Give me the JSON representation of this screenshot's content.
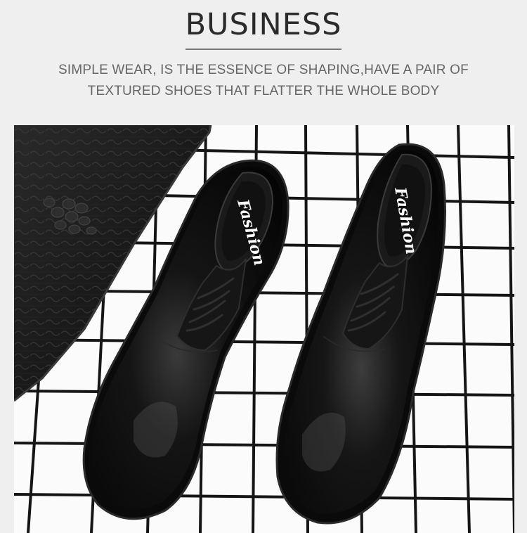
{
  "header": {
    "title": "BUSINESS",
    "subtitle_line1": "SIMPLE WEAR, IS THE ESSENCE OF SHAPING,HAVE A PAIR OF",
    "subtitle_line2": "TEXTURED SHOES THAT FLATTER THE WHOLE BODY"
  },
  "photo": {
    "insole_text_left": "Fashion",
    "insole_text_right": "Fashion",
    "subject": "pair-of-black-derby-shoes-icon",
    "props": [
      "crocodile-leather-bag-icon",
      "grid-pattern-rug-icon"
    ]
  },
  "colors": {
    "title": "#2b2b2b",
    "subtitle": "#666666",
    "shoe_leather": "#0d0d0d",
    "grid_line": "#1a1a1a",
    "grid_background": "#fbfbfb"
  }
}
